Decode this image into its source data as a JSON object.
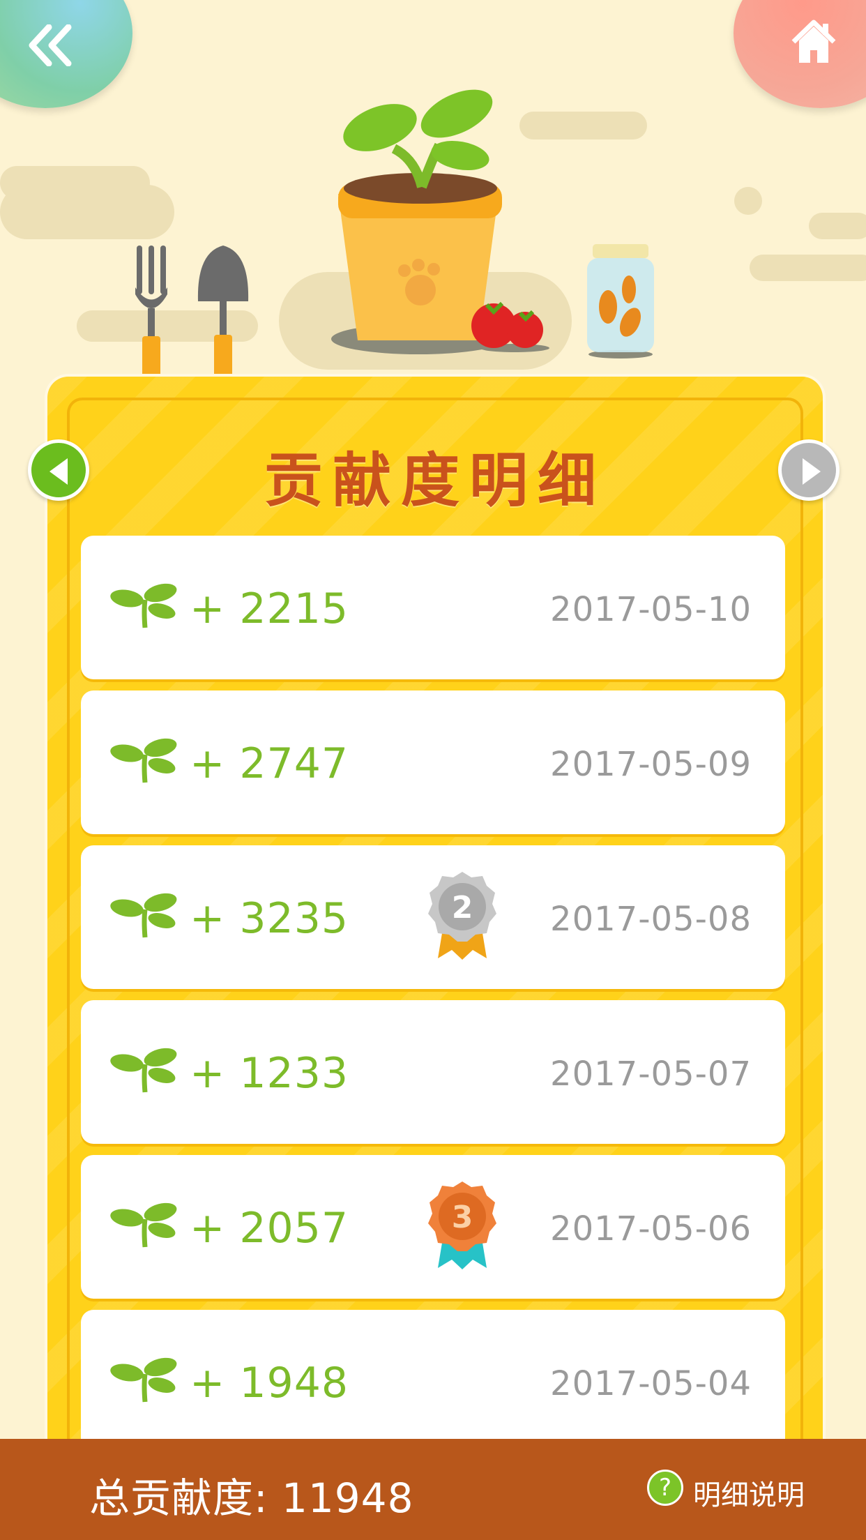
{
  "header": {
    "back_icon": "double-chevron-left-icon",
    "home_icon": "home-icon"
  },
  "card": {
    "title": "贡献度明细",
    "prev_icon": "triangle-left-icon",
    "next_icon": "triangle-right-icon"
  },
  "records": [
    {
      "amount": "+ 2215",
      "date": "2017-05-10",
      "medal": ""
    },
    {
      "amount": "+ 2747",
      "date": "2017-05-09",
      "medal": ""
    },
    {
      "amount": "+ 3235",
      "date": "2017-05-08",
      "medal": "2"
    },
    {
      "amount": "+ 1233",
      "date": "2017-05-07",
      "medal": ""
    },
    {
      "amount": "+ 2057",
      "date": "2017-05-06",
      "medal": "3"
    },
    {
      "amount": "+ 1948",
      "date": "2017-05-04",
      "medal": ""
    }
  ],
  "footer": {
    "total_label": "总贡献度: 11948",
    "help_icon_glyph": "?",
    "help_label": "明细说明"
  },
  "colors": {
    "card": "#ffd21a",
    "footer": "#b8571b",
    "amount_green": "#7dbb2a",
    "title": "#c9521c"
  }
}
